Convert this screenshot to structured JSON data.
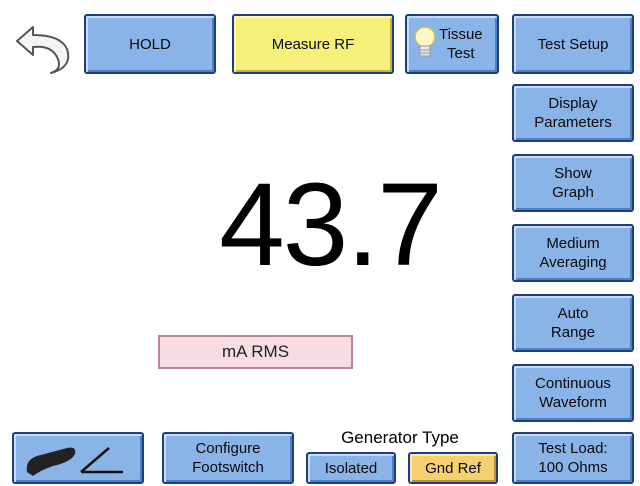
{
  "toolbar": {
    "back_icon": "curved-back-arrow-icon",
    "hold_label": "HOLD",
    "measure_label": "Measure RF",
    "tissue_line1": "Tissue",
    "tissue_line2": "Test",
    "tissue_icon": "lightbulb-icon"
  },
  "side_menu": {
    "test_setup": "Test Setup",
    "display_line1": "Display",
    "display_line2": "Parameters",
    "graph_line1": "Show",
    "graph_line2": "Graph",
    "averaging_line1": "Medium",
    "averaging_line2": "Averaging",
    "range_line1": "Auto",
    "range_line2": "Range",
    "waveform_line1": "Continuous",
    "waveform_line2": "Waveform",
    "load_line1": "Test Load:",
    "load_line2": "100 Ohms"
  },
  "measurement": {
    "value": "43.7",
    "unit": "mA RMS"
  },
  "bottom": {
    "mode_icon": "handpiece-angle-icon",
    "footswitch_line1": "Configure",
    "footswitch_line2": "Footswitch",
    "generator_type_label": "Generator Type",
    "isolated_label": "Isolated",
    "gndref_label": "Gnd Ref"
  },
  "colors": {
    "button_blue": "#8ab4e8",
    "active_yellow": "#f6f07a",
    "selected_orange": "#f7cf73",
    "unit_pink": "#f7dde3"
  }
}
